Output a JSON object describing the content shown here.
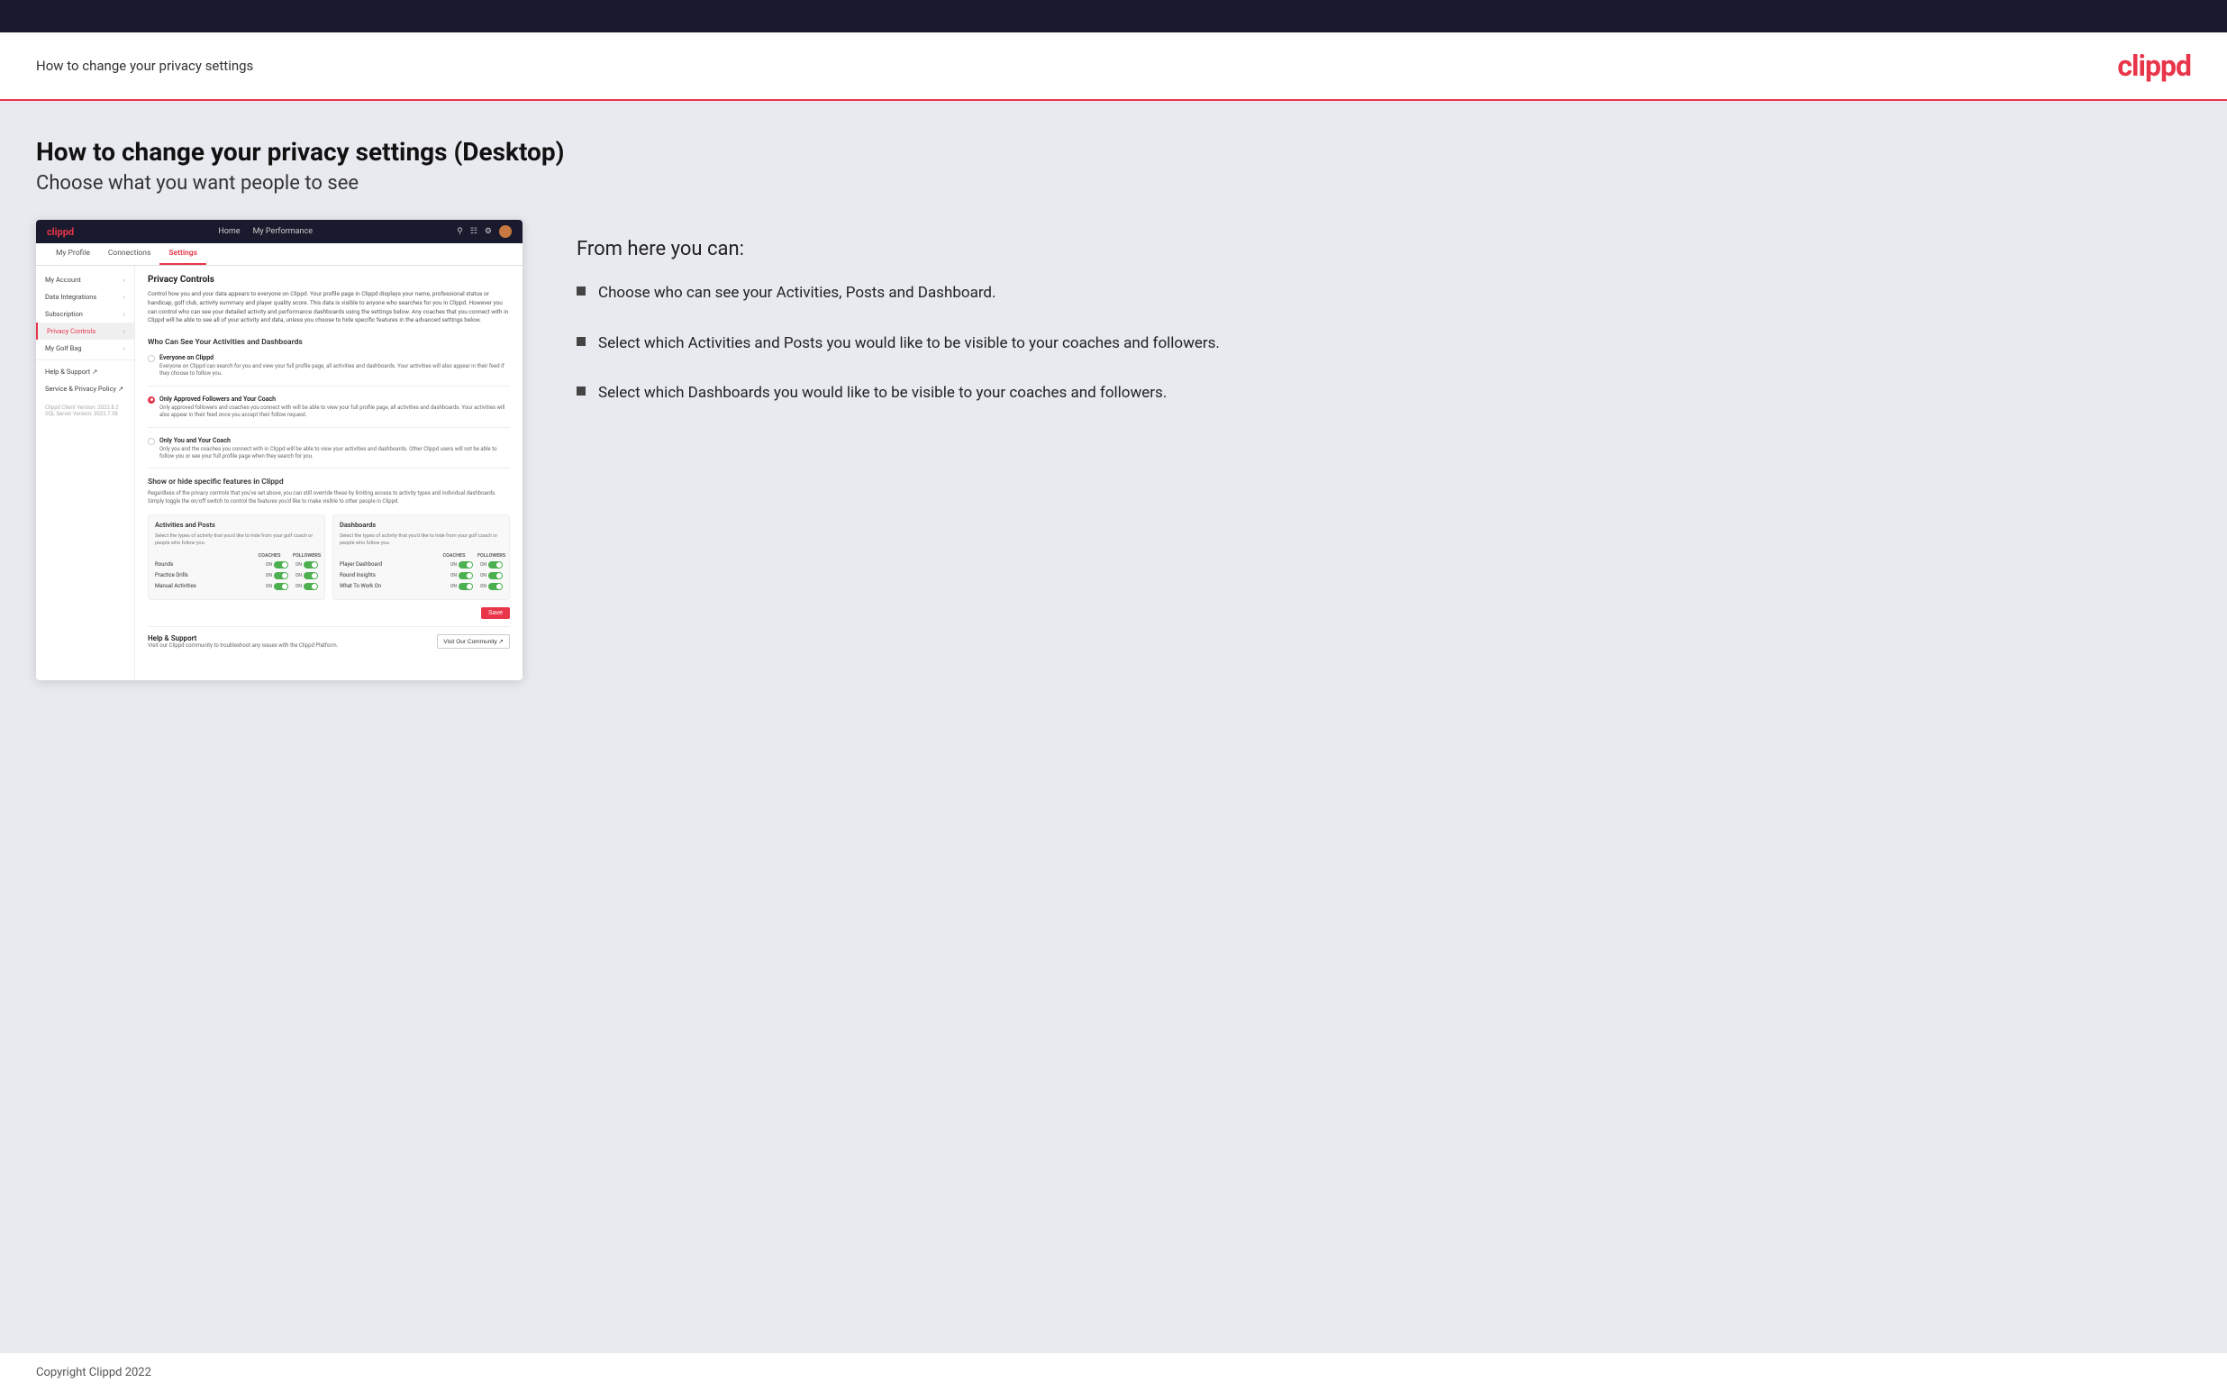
{
  "topBar": {},
  "header": {
    "title": "How to change your privacy settings",
    "logo": "clippd"
  },
  "page": {
    "heading": "How to change your privacy settings (Desktop)",
    "subheading": "Choose what you want people to see"
  },
  "miniApp": {
    "nav": {
      "logo": "clippd",
      "links": [
        "Home",
        "My Performance"
      ],
      "icons": [
        "search",
        "grid",
        "user",
        "avatar"
      ]
    },
    "tabs": [
      "My Profile",
      "Connections",
      "Settings"
    ],
    "activeTab": "Settings",
    "sidebar": {
      "items": [
        {
          "label": "My Account",
          "active": false
        },
        {
          "label": "Data Integrations",
          "active": false
        },
        {
          "label": "Subscription",
          "active": false
        },
        {
          "label": "Privacy Controls",
          "active": true
        },
        {
          "label": "My Golf Bag",
          "active": false
        },
        {
          "label": "Help & Support",
          "active": false,
          "external": true
        },
        {
          "label": "Service & Privacy Policy",
          "active": false,
          "external": true
        }
      ],
      "version": "Clippd Client Version: 2022.8.2\nSQL Server Version: 2022.7.38"
    },
    "privacyControls": {
      "sectionTitle": "Privacy Controls",
      "description": "Control how you and your data appears to everyone on Clippd. Your profile page in Clippd displays your name, professional status or handicap, golf club, activity summary and player quality score. This data is visible to anyone who searches for you in Clippd. However you can control who can see your detailed activity and performance dashboards using the settings below. Any coaches that you connect with in Clippd will be able to see all of your activity and data, unless you choose to hide specific features in the advanced settings below.",
      "whoSectionTitle": "Who Can See Your Activities and Dashboards",
      "options": [
        {
          "label": "Everyone on Clippd",
          "desc": "Everyone on Clippd can search for you and view your full profile page, all activities and dashboards. Your activities will also appear in their feed if they choose to follow you.",
          "selected": false
        },
        {
          "label": "Only Approved Followers and Your Coach",
          "desc": "Only approved followers and coaches you connect with will be able to view your full profile page, all activities and dashboards. Your activities will also appear in their feed once you accept their follow request.",
          "selected": true
        },
        {
          "label": "Only You and Your Coach",
          "desc": "Only you and the coaches you connect with in Clippd will be able to view your activities and dashboards. Other Clippd users will not be able to follow you or see your full profile page when they search for you.",
          "selected": false
        }
      ],
      "showOrHideTitle": "Show or hide specific features in Clippd",
      "showOrHideDesc": "Regardless of the privacy controls that you've set above, you can still override these by limiting access to activity types and individual dashboards. Simply toggle the on/off switch to control the features you'd like to make visible to other people in Clippd.",
      "activitiesAndPosts": {
        "title": "Activities and Posts",
        "desc": "Select the types of activity that you'd like to hide from your golf coach or people who follow you.",
        "headers": [
          "COACHES",
          "FOLLOWERS"
        ],
        "rows": [
          {
            "label": "Rounds",
            "coaches": "ON",
            "followers": "ON"
          },
          {
            "label": "Practice Drills",
            "coaches": "ON",
            "followers": "ON"
          },
          {
            "label": "Manual Activities",
            "coaches": "ON",
            "followers": "ON"
          }
        ]
      },
      "dashboards": {
        "title": "Dashboards",
        "desc": "Select the types of activity that you'd like to hide from your golf coach or people who follow you.",
        "headers": [
          "COACHES",
          "FOLLOWERS"
        ],
        "rows": [
          {
            "label": "Player Dashboard",
            "coaches": "ON",
            "followers": "ON"
          },
          {
            "label": "Round Insights",
            "coaches": "ON",
            "followers": "ON"
          },
          {
            "label": "What To Work On",
            "coaches": "ON",
            "followers": "ON"
          }
        ]
      },
      "saveButton": "Save",
      "helpSection": {
        "title": "Help & Support",
        "desc": "Visit our Clippd community to troubleshoot any issues with the Clippd Platform.",
        "buttonLabel": "Visit Our Community"
      }
    }
  },
  "rightPanel": {
    "fromHereTitle": "From here you can:",
    "bullets": [
      "Choose who can see your Activities, Posts and Dashboard.",
      "Select which Activities and Posts you would like to be visible to your coaches and followers.",
      "Select which Dashboards you would like to be visible to your coaches and followers."
    ]
  },
  "footer": {
    "copyright": "Copyright Clippd 2022"
  }
}
